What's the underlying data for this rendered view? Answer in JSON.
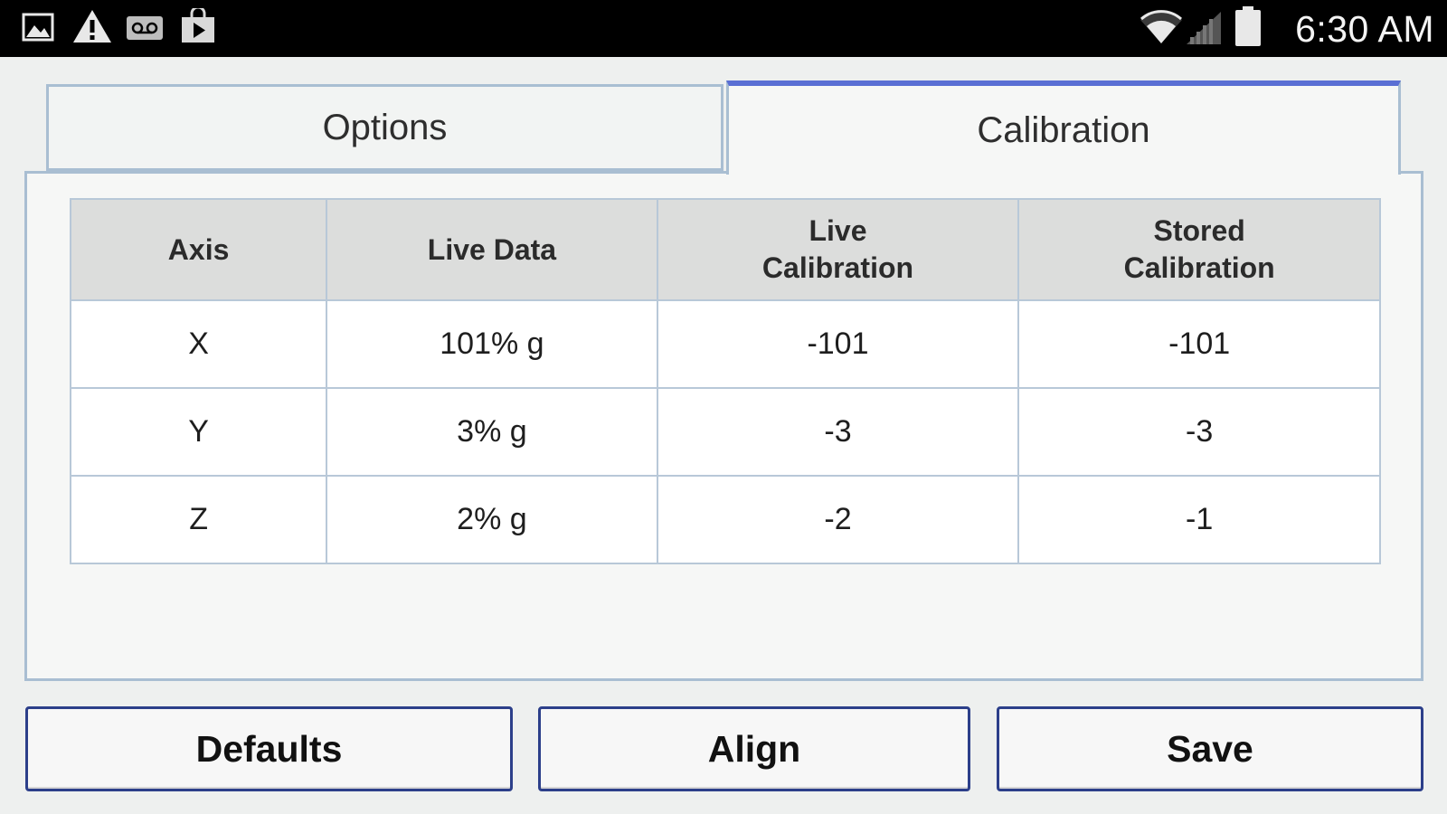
{
  "status_bar": {
    "time": "6:30 AM",
    "left_icons": [
      "gallery-icon",
      "warning-icon",
      "voicemail-icon",
      "play-store-icon"
    ],
    "right_icons": [
      "wifi-icon",
      "signal-icon",
      "battery-icon"
    ]
  },
  "tabs": [
    {
      "label": "Options",
      "selected": false
    },
    {
      "label": "Calibration",
      "selected": true
    }
  ],
  "table": {
    "headers": [
      "Axis",
      "Live Data",
      "Live\nCalibration",
      "Stored\nCalibration"
    ],
    "header_lines": [
      [
        "Axis"
      ],
      [
        "Live Data"
      ],
      [
        "Live",
        "Calibration"
      ],
      [
        "Stored",
        "Calibration"
      ]
    ],
    "rows": [
      [
        "X",
        "101% g",
        "-101",
        "-101"
      ],
      [
        "Y",
        "3% g",
        "-3",
        "-3"
      ],
      [
        "Z",
        "2% g",
        "-2",
        "-1"
      ]
    ]
  },
  "buttons": {
    "defaults_label": "Defaults",
    "align_label": "Align",
    "save_label": "Save"
  },
  "colors": {
    "selected_tab_accent": "#5a6fd4",
    "button_border": "#2c3f8a",
    "frame_border": "#a9bed2"
  }
}
